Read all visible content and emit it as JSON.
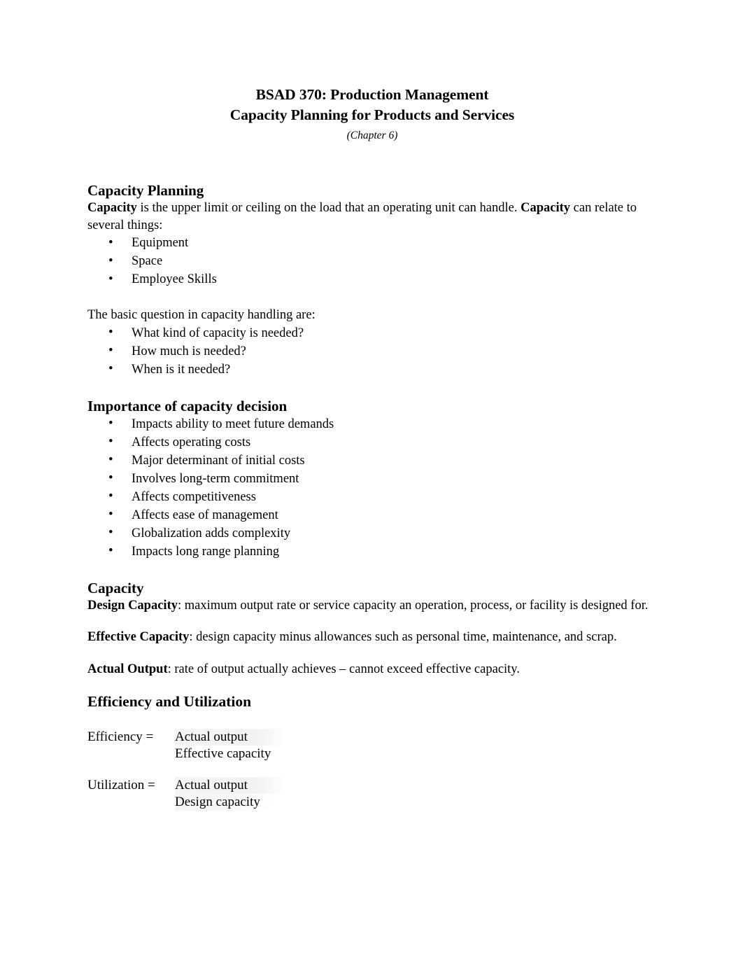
{
  "document": {
    "title_line_1": "BSAD 370: Production Management",
    "title_line_2": "Capacity Planning for Products and Services",
    "subtitle": "(Chapter 6)"
  },
  "sections": {
    "capacity_planning": {
      "heading": "Capacity Planning",
      "intro_bold_1": "Capacity",
      "intro_mid": " is the upper limit or ceiling on the load that an operating unit can handle. ",
      "intro_bold_2": "Capacity",
      "intro_end": " can relate to several things:",
      "bullets": [
        "Equipment",
        "Space",
        "Employee Skills"
      ],
      "question_lead": "The basic question in capacity handling are:",
      "question_bullets": [
        "What kind of capacity is needed?",
        "How much is needed?",
        "When is it needed?"
      ]
    },
    "importance": {
      "heading": "Importance of capacity decision",
      "bullets": [
        "Impacts ability to meet future demands",
        "Affects operating costs",
        "Major determinant of initial costs",
        "Involves long-term commitment",
        "Affects competitiveness",
        "Affects ease of management",
        "Globalization adds complexity",
        "Impacts long range planning"
      ]
    },
    "capacity": {
      "heading": "Capacity",
      "definitions": [
        {
          "term": "Design Capacity",
          "text": ": maximum output rate or service capacity an operation, process, or facility is designed for."
        },
        {
          "term": "Effective Capacity",
          "text": ": design capacity minus allowances such as personal time, maintenance, and scrap."
        },
        {
          "term": "Actual Output",
          "text": ": rate of output actually achieves – cannot exceed effective capacity."
        }
      ]
    },
    "efficiency": {
      "heading": "Efficiency and Utilization",
      "formulas": [
        {
          "label": "Efficiency =",
          "numerator": "Actual output",
          "denominator": "Effective capacity"
        },
        {
          "label": "Utilization =",
          "numerator": "Actual output",
          "denominator": "Design capacity"
        }
      ]
    }
  }
}
